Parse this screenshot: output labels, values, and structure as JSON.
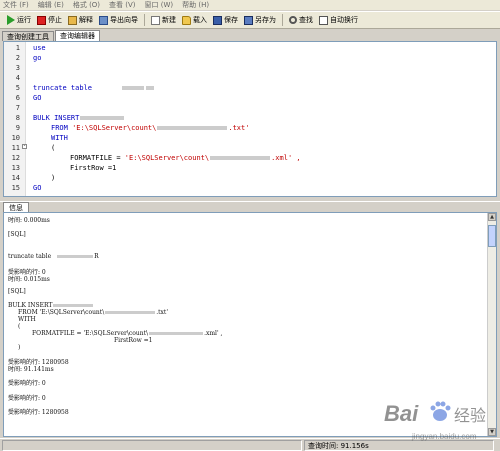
{
  "menu": [
    "文件 (F)",
    "编辑 (E)",
    "格式 (O)",
    "查看 (V)",
    "窗口 (W)",
    "帮助 (H)"
  ],
  "toolbar": {
    "run": "运行",
    "stop": "停止",
    "explain": "解释",
    "export": "导出向导",
    "new": "新建",
    "load": "载入",
    "save": "保存",
    "saveas": "另存为",
    "find": "查找",
    "auto": "自动换行"
  },
  "tabs": [
    "查询创建工具",
    "查询编辑器"
  ],
  "editor": {
    "lines": [
      {
        "n": "1",
        "text": "use"
      },
      {
        "n": "2",
        "text": "go"
      },
      {
        "n": "3",
        "text": ""
      },
      {
        "n": "4",
        "text": ""
      },
      {
        "n": "5",
        "text": "truncate table"
      },
      {
        "n": "6",
        "text": "GO"
      },
      {
        "n": "7",
        "text": ""
      },
      {
        "n": "8",
        "text": "BULK INSERT"
      },
      {
        "n": "9",
        "text": "FROM 'E:\\SQLServer\\count\\"
      },
      {
        "n": "10",
        "text": "WITH"
      },
      {
        "n": "11",
        "text": "("
      },
      {
        "n": "12",
        "text": "FORMATFILE = 'E:\\SQLServer\\count\\"
      },
      {
        "n": "13",
        "text": "FirstRow =1"
      },
      {
        "n": "14",
        "text": ")"
      },
      {
        "n": "15",
        "text": "GO"
      }
    ],
    "line9_tail": ".txt'",
    "line12_tail": ".xml' ,"
  },
  "info_tab": "信息",
  "output": {
    "l1": "时间: 0.000ms",
    "l2": "[SQL]",
    "l3": "truncate table",
    "l3_tail": "R",
    "l4": "受影响的行: 0",
    "l5": "时间: 0.015ms",
    "l6": "[SQL]",
    "l7": "BULK INSERT",
    "l8": "FROM 'E:\\SQLServer\\count\\",
    "l8_tail": ".txt'",
    "l9": "WITH",
    "l10": "(",
    "l11": "FORMATFILE = 'E:\\SQLServer\\count\\",
    "l11_tail": ".xml' ,",
    "l12": "FirstRow =1",
    "l13": ")",
    "l14": "受影响的行: 1280958",
    "l15": "时间: 91.141ms",
    "l16": "受影响的行: 0",
    "l17": "受影响的行: 0",
    "l18": "受影响的行: 1280958"
  },
  "status": {
    "query_time": "查询时间: 91.156s"
  },
  "watermark": {
    "brand": "Bai",
    "brand2": "经验",
    "url": "jingyan.baidu.com"
  }
}
